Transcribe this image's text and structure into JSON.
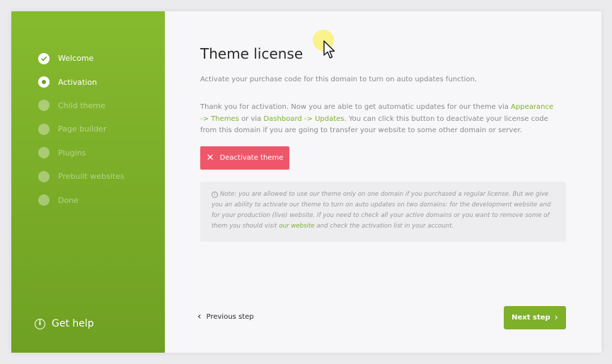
{
  "sidebar": {
    "steps": [
      {
        "label": "Welcome",
        "state": "done"
      },
      {
        "label": "Activation",
        "state": "active"
      },
      {
        "label": "Child theme",
        "state": "pending"
      },
      {
        "label": "Page builder",
        "state": "pending"
      },
      {
        "label": "Plugins",
        "state": "pending"
      },
      {
        "label": "Prebuilt websites",
        "state": "pending"
      },
      {
        "label": "Done",
        "state": "pending"
      }
    ],
    "help_icon": "info-circle-icon",
    "help_label": "Get help"
  },
  "main": {
    "title": "Theme license",
    "subtitle": "Activate your purchase code for this domain to turn on auto updates function.",
    "body": {
      "t1": "Thank you for activation. Now you are able to get automatic updates for our theme via ",
      "link1": "Appearance -> Themes",
      "t2": " or via ",
      "link2": "Dashboard -> Updates",
      "t3": ". You can click this button to deactivate your license code from this domain if you are going to transfer your website to some other domain or server."
    },
    "deactivate_label": "Deactivate theme",
    "note": {
      "icon": "info-circle-icon",
      "t1": "Note: you are allowed to use our theme only on one domain if you purchased a regular license. But we give you an ability to activate our theme to turn on auto updates on two domains: for the development website and for your production (live) website. If you need to check all your active domains or you want to remove some of them you should visit ",
      "link": "our website",
      "t2": " and check the activation list in your account."
    },
    "prev_label": "Previous step",
    "next_label": "Next step"
  },
  "colors": {
    "brand_green": "#7fb02b",
    "danger": "#f0566a",
    "sidebar_top": "#86ba2e",
    "sidebar_bottom": "#6fa023"
  }
}
